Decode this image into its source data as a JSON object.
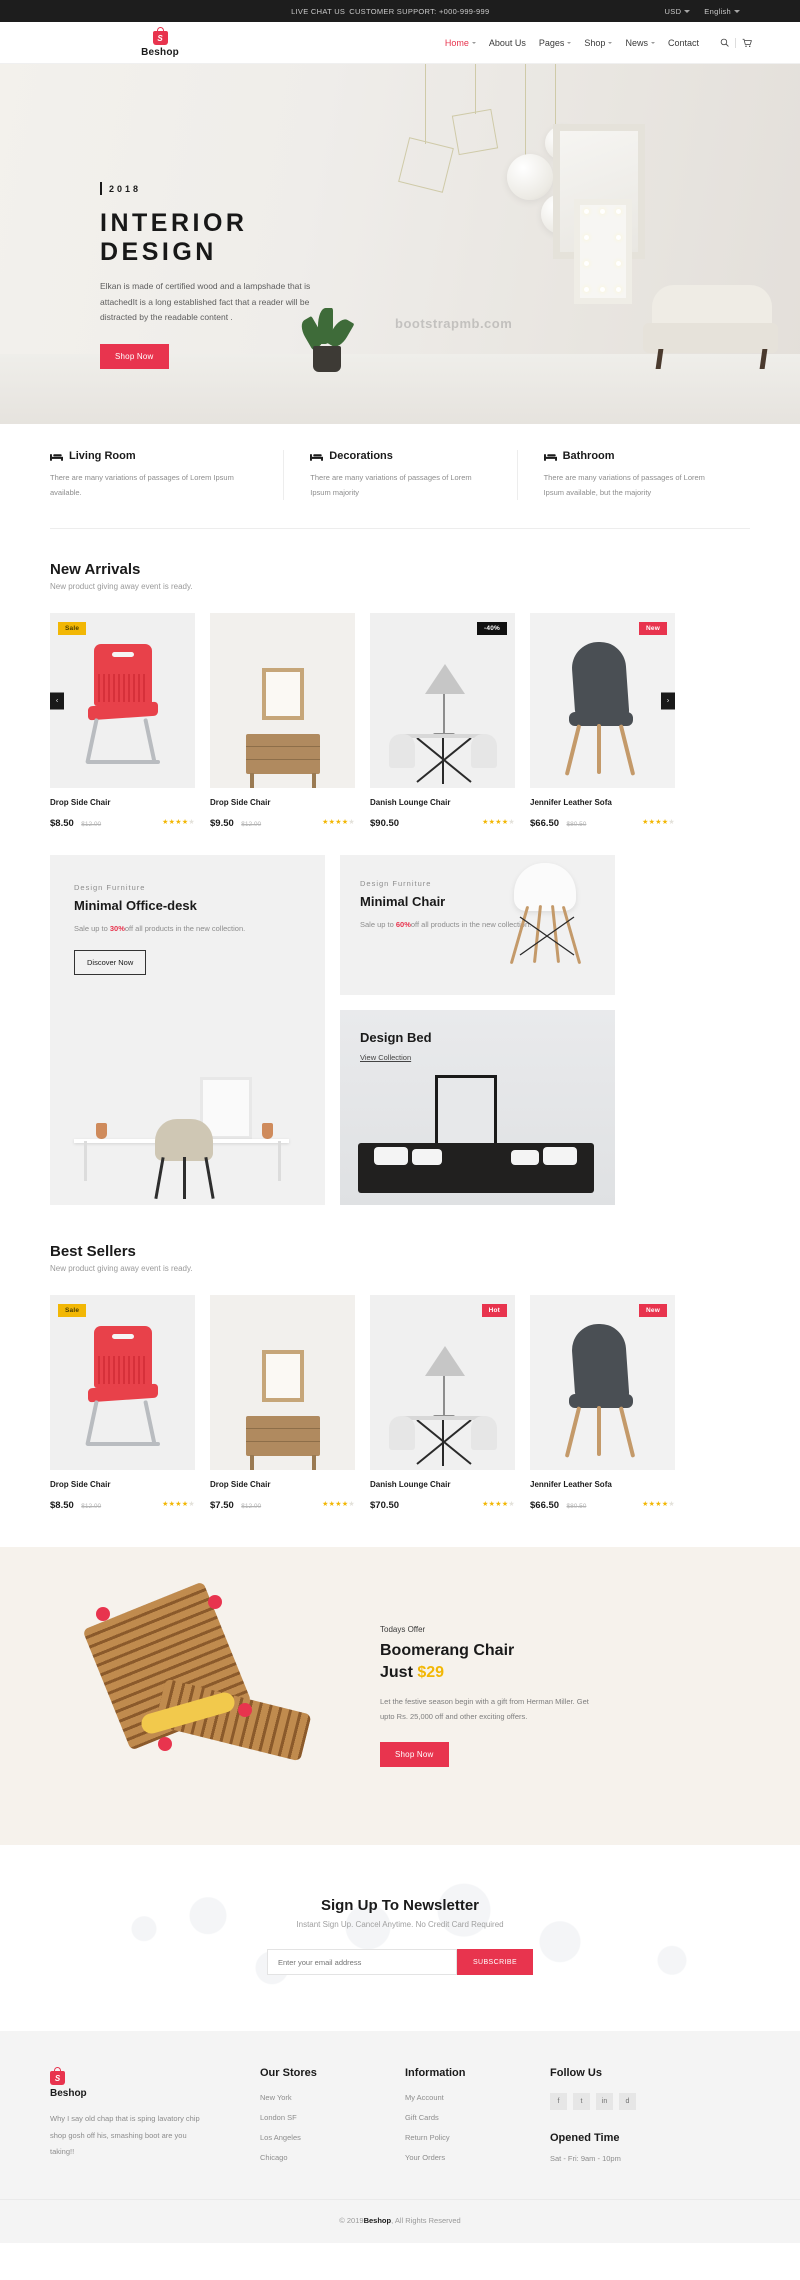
{
  "topbar": {
    "live_chat": "LIVE CHAT US",
    "support": "CUSTOMER SUPPORT: +000-999-999",
    "currency": "USD",
    "language": "English"
  },
  "header": {
    "brand": "Beshop",
    "nav": [
      {
        "label": "Home",
        "has_caret": true,
        "active": true
      },
      {
        "label": "About Us",
        "has_caret": false,
        "active": false
      },
      {
        "label": "Pages",
        "has_caret": true,
        "active": false
      },
      {
        "label": "Shop",
        "has_caret": true,
        "active": false
      },
      {
        "label": "News",
        "has_caret": true,
        "active": false
      },
      {
        "label": "Contact",
        "has_caret": false,
        "active": false
      }
    ],
    "search_icon": "search-icon",
    "cart_icon": "cart-icon"
  },
  "hero": {
    "year": "2018",
    "title": "INTERIOR DESIGN",
    "description": "Elkan is made of certified wood and a lampshade that is attachedIt is a long established fact that a reader will be distracted by the readable content .",
    "cta": "Shop Now",
    "watermark": "bootstrapmb.com"
  },
  "features": [
    {
      "icon": "bed-icon",
      "title": "Living Room",
      "text": "There are many variations of passages of Lorem Ipsum available."
    },
    {
      "icon": "bed-icon",
      "title": "Decorations",
      "text": "There are many variations of passages of Lorem Ipsum majority"
    },
    {
      "icon": "bed-icon",
      "title": "Bathroom",
      "text": "There are many variations of passages of Lorem Ipsum available, but the majority"
    }
  ],
  "new_arrivals": {
    "title": "New Arrivals",
    "subtitle": "New product giving away event is ready.",
    "products": [
      {
        "name": "Drop Side Chair",
        "price": "$8.50",
        "old_price": "$12.00",
        "badge": "Sale",
        "badge_type": "sale",
        "stars": 4,
        "art": "chair-red",
        "arrow": "left"
      },
      {
        "name": "Drop Side Chair",
        "price": "$9.50",
        "old_price": "$12.00",
        "badge": "",
        "badge_type": "",
        "stars": 4,
        "art": "dresser",
        "arrow": ""
      },
      {
        "name": "Danish Lounge Chair",
        "price": "$90.50",
        "old_price": "",
        "badge": "-40%",
        "badge_type": "off",
        "stars": 4,
        "art": "lamptable",
        "arrow": ""
      },
      {
        "name": "Jennifer Leather Sofa",
        "price": "$66.50",
        "old_price": "$80.50",
        "badge": "New",
        "badge_type": "new",
        "stars": 4,
        "art": "chair-dark",
        "arrow": "right"
      }
    ]
  },
  "promos": {
    "desk": {
      "eyebrow": "Design Furniture",
      "title": "Minimal Office-desk",
      "text_before": "Sale up to ",
      "highlight": "30%",
      "text_after": "off all products in the new collection.",
      "cta": "Discover Now"
    },
    "chair": {
      "eyebrow": "Design Furniture",
      "title": "Minimal Chair",
      "text_before": "Sale up to ",
      "highlight": "60%",
      "text_after": "off all products in the new collection."
    },
    "bed": {
      "title": "Design Bed",
      "link": "View Collection"
    }
  },
  "best_sellers": {
    "title": "Best Sellers",
    "subtitle": "New product giving away event is ready.",
    "products": [
      {
        "name": "Drop Side Chair",
        "price": "$8.50",
        "old_price": "$12.00",
        "badge": "Sale",
        "badge_type": "sale",
        "stars": 4,
        "art": "chair-red",
        "arrow": ""
      },
      {
        "name": "Drop Side Chair",
        "price": "$7.50",
        "old_price": "$12.00",
        "badge": "",
        "badge_type": "",
        "stars": 4,
        "art": "dresser",
        "arrow": ""
      },
      {
        "name": "Danish Lounge Chair",
        "price": "$70.50",
        "old_price": "",
        "badge": "Hot",
        "badge_type": "new",
        "stars": 4,
        "art": "lamptable",
        "arrow": ""
      },
      {
        "name": "Jennifer Leather Sofa",
        "price": "$66.50",
        "old_price": "$80.50",
        "badge": "New",
        "badge_type": "new",
        "stars": 4,
        "art": "chair-dark",
        "arrow": ""
      }
    ]
  },
  "offer": {
    "eyebrow": "Todays Offer",
    "title_line1": "Boomerang Chair",
    "title_line2": "Just ",
    "amount": "$29",
    "text": "Let the festive season begin with a gift from Herman Miller. Get upto Rs. 25,000 off and other exciting offers.",
    "cta": "Shop Now"
  },
  "newsletter": {
    "title": "Sign Up To Newsletter",
    "subtitle": "Instant Sign Up. Cancel Anytime. No Credit Card Required",
    "placeholder": "Enter your email address",
    "button": "SUBSCRIBE"
  },
  "footer": {
    "brand": "Beshop",
    "description": "Why I say old chap that is sping lavatory chip shop gosh off his, smashing boot are you taking!!",
    "stores": {
      "title": "Our Stores",
      "items": [
        "New York",
        "London SF",
        "Los Angeles",
        "Chicago"
      ]
    },
    "information": {
      "title": "Information",
      "items": [
        "My Account",
        "Gift Cards",
        "Return Policy",
        "Your Orders"
      ]
    },
    "follow": {
      "title": "Follow Us",
      "socials": [
        "facebook-icon",
        "twitter-icon",
        "linkedin-icon",
        "dribbble-icon"
      ],
      "glyphs": [
        "f",
        "t",
        "in",
        "d"
      ]
    },
    "opened": {
      "title": "Opened Time",
      "value": "Sat - Fri: 9am - 10pm"
    },
    "copyright_prefix": "© 2019",
    "copyright_brand": "Beshop",
    "copyright_suffix": ", All Rights Reserved"
  },
  "colors": {
    "accent": "#e8344e",
    "gold": "#f2b705",
    "dark": "#1d1d1d"
  }
}
